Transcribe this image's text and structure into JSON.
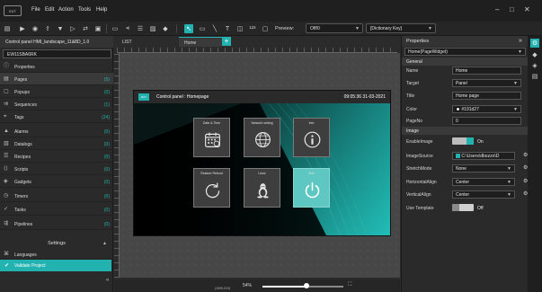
{
  "menubar": {
    "logo": "EXT",
    "items": [
      "File",
      "Edit",
      "Action",
      "Tools",
      "Help"
    ]
  },
  "toolbar": {
    "preview_label": "Preview:",
    "preview_value": "Off/0",
    "dictionary_value": "[Dictionary Key]"
  },
  "left_panel": {
    "project_title": "Control panel HMI_landscape_11&8D_1.0",
    "device": "EW11SBA6RK",
    "items": [
      {
        "label": "Properties",
        "count": "",
        "icon": "info-icon"
      },
      {
        "label": "Pages",
        "count": "(5)",
        "icon": "pages-icon"
      },
      {
        "label": "Popups",
        "count": "(0)",
        "icon": "popups-icon"
      },
      {
        "label": "Sequences",
        "count": "(1)",
        "icon": "sequences-icon"
      },
      {
        "label": "Tags",
        "count": "(24)",
        "icon": "tags-icon"
      },
      {
        "label": "Alarms",
        "count": "(0)",
        "icon": "alarms-icon"
      },
      {
        "label": "Datalogs",
        "count": "(0)",
        "icon": "datalogs-icon"
      },
      {
        "label": "Recipes",
        "count": "(0)",
        "icon": "recipes-icon"
      },
      {
        "label": "Scripts",
        "count": "(0)",
        "icon": "scripts-icon"
      },
      {
        "label": "Gadgets",
        "count": "(0)",
        "icon": "gadgets-icon"
      },
      {
        "label": "Timers",
        "count": "(0)",
        "icon": "timers-icon"
      },
      {
        "label": "Tasks",
        "count": "(0)",
        "icon": "tasks-icon"
      },
      {
        "label": "Pipelines",
        "count": "(0)",
        "icon": "pipelines-icon"
      }
    ],
    "settings_label": "Settings",
    "languages_label": "Languages",
    "validate_label": "Validate Project"
  },
  "tabs": {
    "list_label": "LIST",
    "home_label": "Home",
    "add_label": "+"
  },
  "hmi": {
    "logo": "EXT",
    "title": "Control panel : Homepage",
    "time": "09:05:36 31-03-2021",
    "tiles": [
      {
        "label": "Date & Time",
        "icon": "calendar-icon"
      },
      {
        "label": "Network setting",
        "icon": "globe-icon"
      },
      {
        "label": "Info",
        "icon": "info-icon"
      },
      {
        "label": "Restore Reboot",
        "icon": "restart-icon"
      },
      {
        "label": "Linux",
        "icon": "linux-icon"
      },
      {
        "label": "Exit",
        "icon": "power-icon"
      }
    ]
  },
  "properties": {
    "title": "Properties",
    "selected_widget": "Home(PageWidget)",
    "general_label": "General",
    "name_label": "Name",
    "name_value": "Home",
    "target_label": "Target",
    "target_value": "Panel",
    "title_label": "Title",
    "title_value": "Home page",
    "color_label": "Color",
    "color_value": "#191d27",
    "pageno_label": "PageNo",
    "pageno_value": "0",
    "image_label": "Image",
    "enable_image_label": "EnableImage",
    "enable_image_state": "On",
    "image_source_label": "ImageSource",
    "image_source_value": "C:\\Users\\dbozzo\\D",
    "stretch_label": "StretchMode",
    "stretch_value": "None",
    "halign_label": "HorizontalAlign",
    "halign_value": "Center",
    "valign_label": "VerticalAlign",
    "valign_value": "Center",
    "use_template_label": "Use Template",
    "use_template_state": "Off"
  },
  "status": {
    "zoom": "54%",
    "zoom_fraction": 0.54,
    "coords": "(1099,219)"
  },
  "colors": {
    "accent": "#22b3b0",
    "page_color": "#191d27"
  }
}
